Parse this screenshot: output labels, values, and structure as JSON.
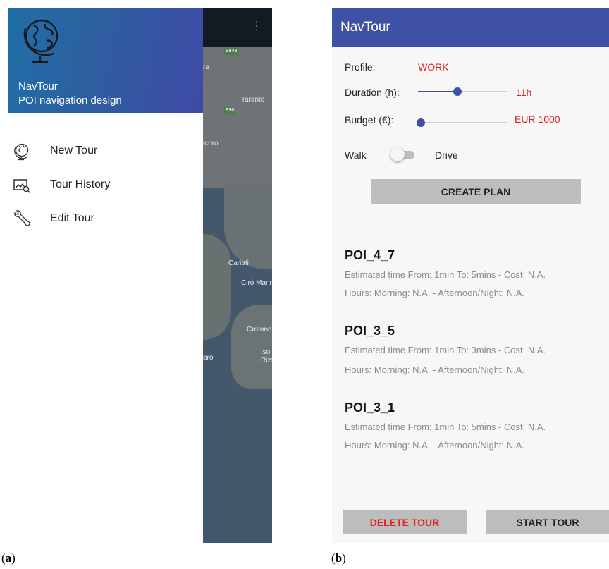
{
  "captions": {
    "a": {
      "open": "(",
      "letter": "a",
      "close": ")"
    },
    "b": {
      "open": "(",
      "letter": "b",
      "close": ")"
    }
  },
  "panel_a": {
    "drawer": {
      "app_name": "NavTour",
      "subtitle": "POI navigation design",
      "logo_icon": "globe-icon",
      "items": [
        {
          "label": "New Tour",
          "icon": "globe-icon"
        },
        {
          "label": "Tour History",
          "icon": "image-search-icon"
        },
        {
          "label": "Edit Tour",
          "icon": "wrench-icon"
        }
      ]
    },
    "map_labels": [
      "ra",
      "Taranto",
      "icoro",
      "Cariati",
      "Cirò Marina",
      "Crotone",
      "aro",
      "Isola di",
      "Rizzuto"
    ],
    "road_labels": [
      "E843",
      "E90"
    ],
    "menu_icon": "kebab-icon"
  },
  "panel_b": {
    "appbar_title": "NavTour",
    "profile": {
      "label": "Profile:",
      "value": "WORK"
    },
    "duration": {
      "label": "Duration (h):",
      "value": "11h",
      "level": 0.45
    },
    "budget": {
      "label": "Budget (€):",
      "value": "EUR 1000",
      "level": 0.0
    },
    "mode": {
      "left": "Walk",
      "right": "Drive",
      "on": false
    },
    "create_plan_label": "CREATE PLAN",
    "pois": [
      {
        "name": "POI_4_7",
        "line1": "Estimated time From: 1min  To: 5mins - Cost: N.A.",
        "line2": "Hours: Morning: N.A. - Afternoon/Night: N.A."
      },
      {
        "name": "POI_3_5",
        "line1": "Estimated time From: 1min  To: 3mins - Cost: N.A.",
        "line2": "Hours: Morning: N.A. - Afternoon/Night: N.A."
      },
      {
        "name": "POI_3_1",
        "line1": "Estimated time From: 1min  To: 5mins - Cost: N.A.",
        "line2": "Hours: Morning: N.A. - Afternoon/Night: N.A."
      }
    ],
    "delete_label": "DELETE TOUR",
    "start_label": "START TOUR"
  },
  "colors": {
    "primary": "#3f51a5",
    "accent_red": "#e32020",
    "button_grey": "#bdbdbd"
  }
}
